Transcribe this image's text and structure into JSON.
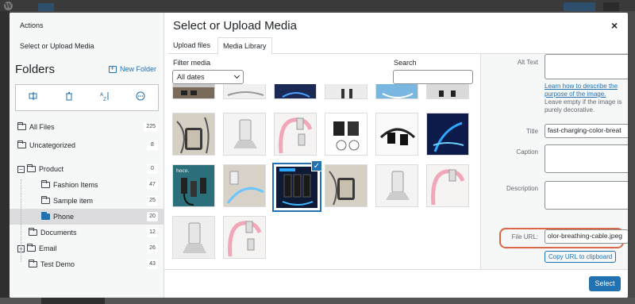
{
  "left_panel": {
    "actions": "Actions",
    "select_upload": "Select or Upload Media",
    "folders_title": "Folders",
    "new_folder": "New Folder",
    "tree": [
      {
        "label": "All Files",
        "count": "225"
      },
      {
        "label": "Uncategorized",
        "count": "8"
      },
      {
        "label": "Product",
        "count": "0"
      },
      {
        "label": "Fashion Items",
        "count": "47"
      },
      {
        "label": "Sample item",
        "count": "25"
      },
      {
        "label": "Phone",
        "count": "20"
      },
      {
        "label": "Documents",
        "count": "12"
      },
      {
        "label": "Email",
        "count": "26"
      },
      {
        "label": "Test Demo",
        "count": "43"
      }
    ]
  },
  "modal": {
    "title": "Select or Upload Media",
    "close": "×",
    "tabs": [
      "Upload files",
      "Media Library"
    ],
    "filter_label": "Filter media",
    "filter_value": "All dates",
    "search_label": "Search",
    "select_button": "Select",
    "selected_check": "✓"
  },
  "details": {
    "alt_text_label": "Alt Text",
    "help_link": "Learn how to describe the purpose of the image.",
    "help_text": " Leave empty if the image is purely decorative.",
    "title_label": "Title",
    "title_value": "fast-charging-color-breat",
    "caption_label": "Caption",
    "description_label": "Description",
    "file_url_label": "File URL:",
    "file_url_value": "olor-breathing-cable.jpeg",
    "copy_button": "Copy URL to clipboard"
  },
  "accent_color": "#2271b1",
  "highlight_color": "#d9694a"
}
